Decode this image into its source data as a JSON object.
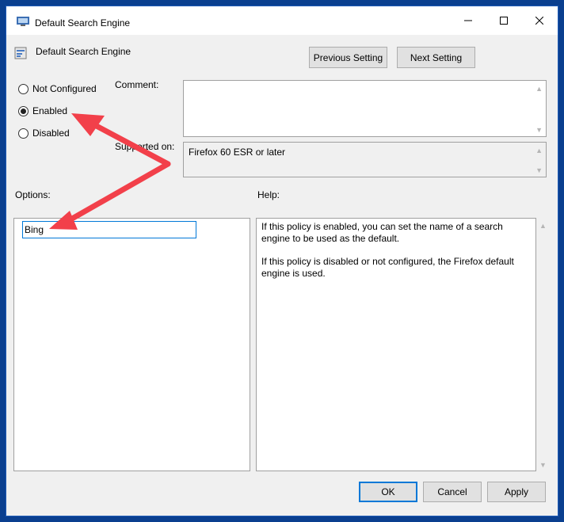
{
  "window": {
    "title": "Default Search Engine",
    "header_title": "Default Search Engine"
  },
  "nav": {
    "previous_label": "Previous Setting",
    "next_label": "Next Setting"
  },
  "state": {
    "options": [
      {
        "label": "Not Configured",
        "checked": false
      },
      {
        "label": "Enabled",
        "checked": true
      },
      {
        "label": "Disabled",
        "checked": false
      }
    ]
  },
  "comment": {
    "label": "Comment:",
    "value": ""
  },
  "supported": {
    "label": "Supported on:",
    "value": "Firefox 60 ESR or later"
  },
  "options_panel": {
    "label": "Options:",
    "search_engine_value": "Bing"
  },
  "help_panel": {
    "label": "Help:",
    "paragraphs": [
      "If this policy is enabled, you can set the name of a search engine to be used as the default.",
      "If this policy is disabled or not configured, the Firefox default engine is used."
    ]
  },
  "footer": {
    "ok_label": "OK",
    "cancel_label": "Cancel",
    "apply_label": "Apply"
  },
  "colors": {
    "desktop": "#0a3f8f",
    "annotation_arrow": "#f2404a",
    "focus": "#0078d7"
  }
}
